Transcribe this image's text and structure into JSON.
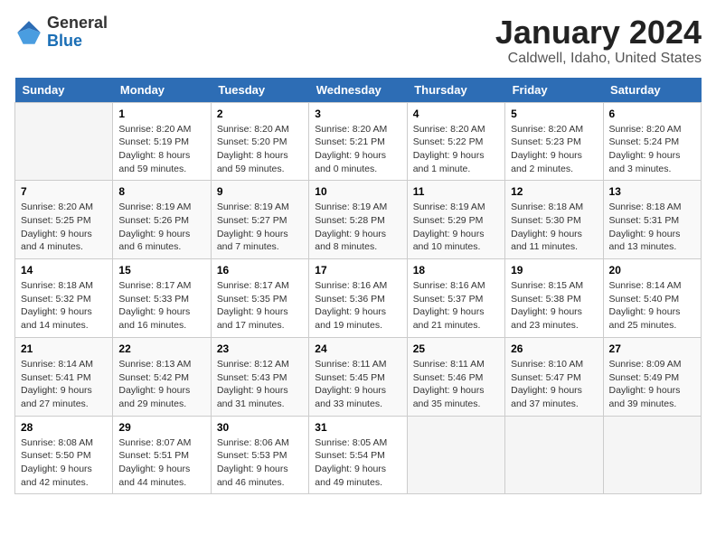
{
  "logo": {
    "general": "General",
    "blue": "Blue"
  },
  "header": {
    "title": "January 2024",
    "subtitle": "Caldwell, Idaho, United States"
  },
  "weekdays": [
    "Sunday",
    "Monday",
    "Tuesday",
    "Wednesday",
    "Thursday",
    "Friday",
    "Saturday"
  ],
  "weeks": [
    [
      {
        "day": "",
        "empty": true
      },
      {
        "day": "1",
        "sunrise": "Sunrise: 8:20 AM",
        "sunset": "Sunset: 5:19 PM",
        "daylight": "Daylight: 8 hours and 59 minutes."
      },
      {
        "day": "2",
        "sunrise": "Sunrise: 8:20 AM",
        "sunset": "Sunset: 5:20 PM",
        "daylight": "Daylight: 8 hours and 59 minutes."
      },
      {
        "day": "3",
        "sunrise": "Sunrise: 8:20 AM",
        "sunset": "Sunset: 5:21 PM",
        "daylight": "Daylight: 9 hours and 0 minutes."
      },
      {
        "day": "4",
        "sunrise": "Sunrise: 8:20 AM",
        "sunset": "Sunset: 5:22 PM",
        "daylight": "Daylight: 9 hours and 1 minute."
      },
      {
        "day": "5",
        "sunrise": "Sunrise: 8:20 AM",
        "sunset": "Sunset: 5:23 PM",
        "daylight": "Daylight: 9 hours and 2 minutes."
      },
      {
        "day": "6",
        "sunrise": "Sunrise: 8:20 AM",
        "sunset": "Sunset: 5:24 PM",
        "daylight": "Daylight: 9 hours and 3 minutes."
      }
    ],
    [
      {
        "day": "7",
        "sunrise": "Sunrise: 8:20 AM",
        "sunset": "Sunset: 5:25 PM",
        "daylight": "Daylight: 9 hours and 4 minutes."
      },
      {
        "day": "8",
        "sunrise": "Sunrise: 8:19 AM",
        "sunset": "Sunset: 5:26 PM",
        "daylight": "Daylight: 9 hours and 6 minutes."
      },
      {
        "day": "9",
        "sunrise": "Sunrise: 8:19 AM",
        "sunset": "Sunset: 5:27 PM",
        "daylight": "Daylight: 9 hours and 7 minutes."
      },
      {
        "day": "10",
        "sunrise": "Sunrise: 8:19 AM",
        "sunset": "Sunset: 5:28 PM",
        "daylight": "Daylight: 9 hours and 8 minutes."
      },
      {
        "day": "11",
        "sunrise": "Sunrise: 8:19 AM",
        "sunset": "Sunset: 5:29 PM",
        "daylight": "Daylight: 9 hours and 10 minutes."
      },
      {
        "day": "12",
        "sunrise": "Sunrise: 8:18 AM",
        "sunset": "Sunset: 5:30 PM",
        "daylight": "Daylight: 9 hours and 11 minutes."
      },
      {
        "day": "13",
        "sunrise": "Sunrise: 8:18 AM",
        "sunset": "Sunset: 5:31 PM",
        "daylight": "Daylight: 9 hours and 13 minutes."
      }
    ],
    [
      {
        "day": "14",
        "sunrise": "Sunrise: 8:18 AM",
        "sunset": "Sunset: 5:32 PM",
        "daylight": "Daylight: 9 hours and 14 minutes."
      },
      {
        "day": "15",
        "sunrise": "Sunrise: 8:17 AM",
        "sunset": "Sunset: 5:33 PM",
        "daylight": "Daylight: 9 hours and 16 minutes."
      },
      {
        "day": "16",
        "sunrise": "Sunrise: 8:17 AM",
        "sunset": "Sunset: 5:35 PM",
        "daylight": "Daylight: 9 hours and 17 minutes."
      },
      {
        "day": "17",
        "sunrise": "Sunrise: 8:16 AM",
        "sunset": "Sunset: 5:36 PM",
        "daylight": "Daylight: 9 hours and 19 minutes."
      },
      {
        "day": "18",
        "sunrise": "Sunrise: 8:16 AM",
        "sunset": "Sunset: 5:37 PM",
        "daylight": "Daylight: 9 hours and 21 minutes."
      },
      {
        "day": "19",
        "sunrise": "Sunrise: 8:15 AM",
        "sunset": "Sunset: 5:38 PM",
        "daylight": "Daylight: 9 hours and 23 minutes."
      },
      {
        "day": "20",
        "sunrise": "Sunrise: 8:14 AM",
        "sunset": "Sunset: 5:40 PM",
        "daylight": "Daylight: 9 hours and 25 minutes."
      }
    ],
    [
      {
        "day": "21",
        "sunrise": "Sunrise: 8:14 AM",
        "sunset": "Sunset: 5:41 PM",
        "daylight": "Daylight: 9 hours and 27 minutes."
      },
      {
        "day": "22",
        "sunrise": "Sunrise: 8:13 AM",
        "sunset": "Sunset: 5:42 PM",
        "daylight": "Daylight: 9 hours and 29 minutes."
      },
      {
        "day": "23",
        "sunrise": "Sunrise: 8:12 AM",
        "sunset": "Sunset: 5:43 PM",
        "daylight": "Daylight: 9 hours and 31 minutes."
      },
      {
        "day": "24",
        "sunrise": "Sunrise: 8:11 AM",
        "sunset": "Sunset: 5:45 PM",
        "daylight": "Daylight: 9 hours and 33 minutes."
      },
      {
        "day": "25",
        "sunrise": "Sunrise: 8:11 AM",
        "sunset": "Sunset: 5:46 PM",
        "daylight": "Daylight: 9 hours and 35 minutes."
      },
      {
        "day": "26",
        "sunrise": "Sunrise: 8:10 AM",
        "sunset": "Sunset: 5:47 PM",
        "daylight": "Daylight: 9 hours and 37 minutes."
      },
      {
        "day": "27",
        "sunrise": "Sunrise: 8:09 AM",
        "sunset": "Sunset: 5:49 PM",
        "daylight": "Daylight: 9 hours and 39 minutes."
      }
    ],
    [
      {
        "day": "28",
        "sunrise": "Sunrise: 8:08 AM",
        "sunset": "Sunset: 5:50 PM",
        "daylight": "Daylight: 9 hours and 42 minutes."
      },
      {
        "day": "29",
        "sunrise": "Sunrise: 8:07 AM",
        "sunset": "Sunset: 5:51 PM",
        "daylight": "Daylight: 9 hours and 44 minutes."
      },
      {
        "day": "30",
        "sunrise": "Sunrise: 8:06 AM",
        "sunset": "Sunset: 5:53 PM",
        "daylight": "Daylight: 9 hours and 46 minutes."
      },
      {
        "day": "31",
        "sunrise": "Sunrise: 8:05 AM",
        "sunset": "Sunset: 5:54 PM",
        "daylight": "Daylight: 9 hours and 49 minutes."
      },
      {
        "day": "",
        "empty": true
      },
      {
        "day": "",
        "empty": true
      },
      {
        "day": "",
        "empty": true
      }
    ]
  ]
}
